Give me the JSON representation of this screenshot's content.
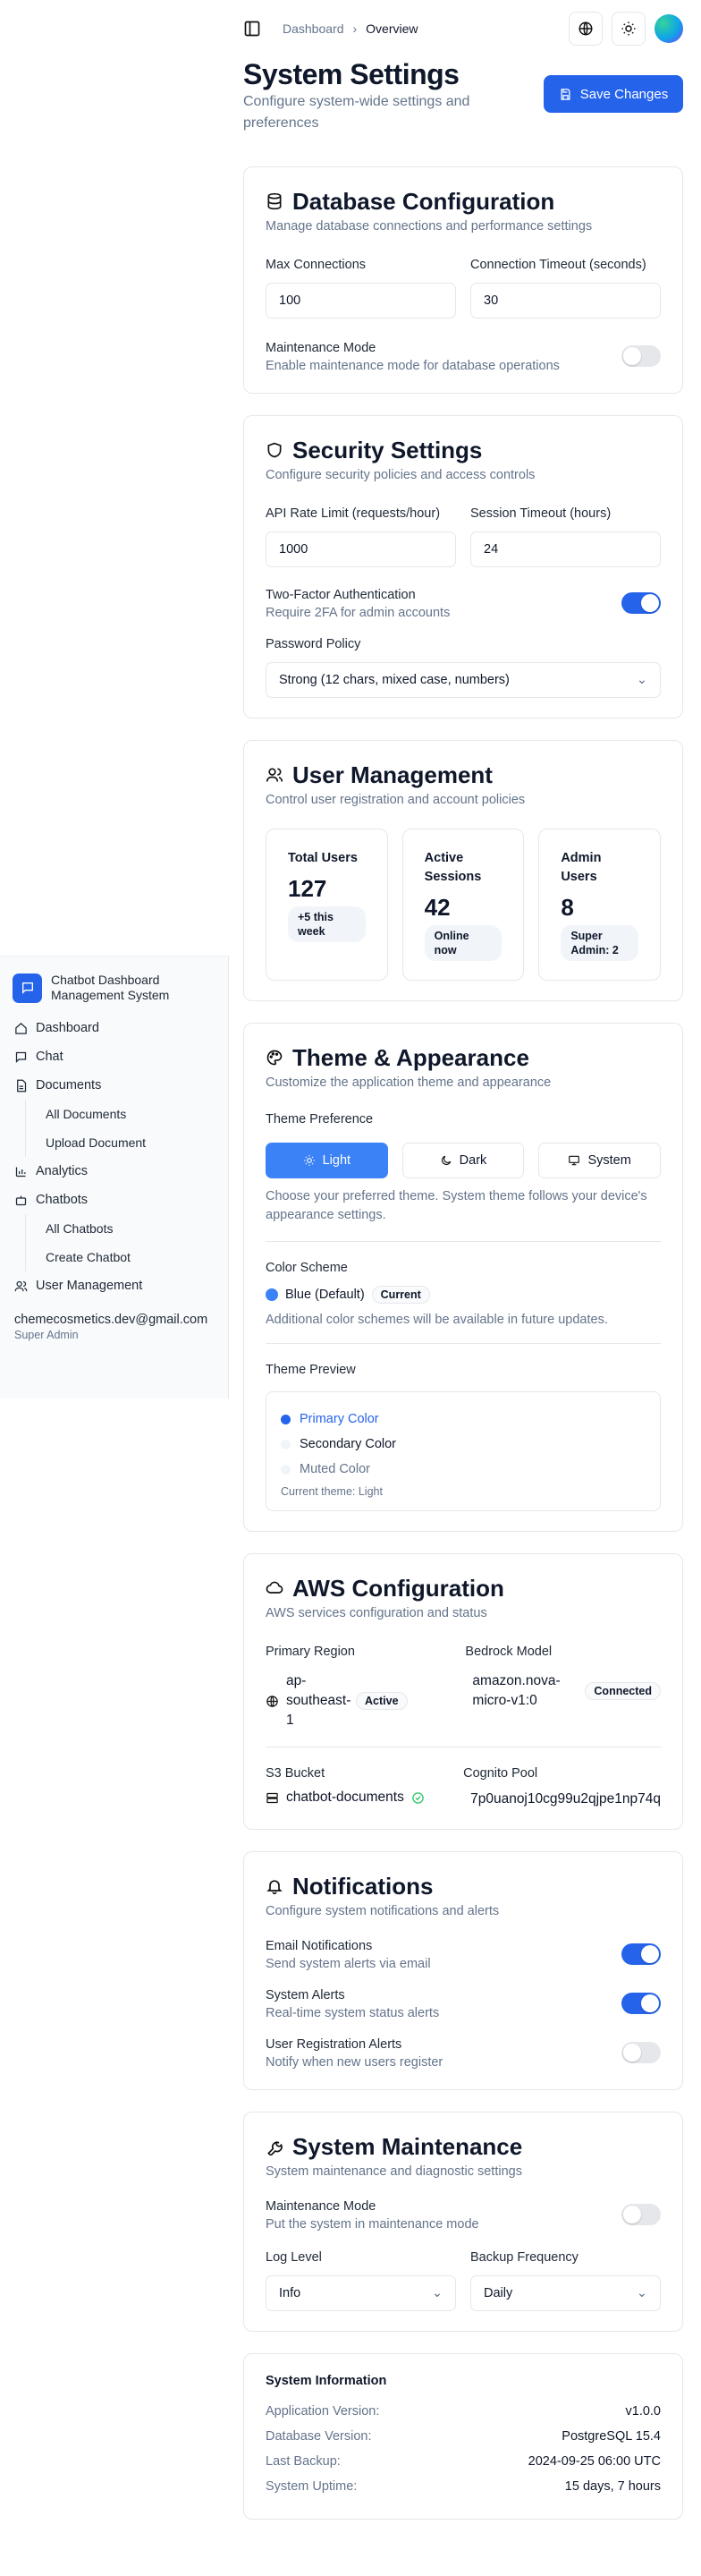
{
  "sidebar": {
    "brand_line1": "Chatbot Dashboard",
    "brand_line2": "Management System",
    "items": [
      {
        "label": "Dashboard"
      },
      {
        "label": "Chat"
      },
      {
        "label": "Documents"
      },
      {
        "label": "All Documents"
      },
      {
        "label": "Upload Document"
      },
      {
        "label": "Analytics"
      },
      {
        "label": "Chatbots"
      },
      {
        "label": "All Chatbots"
      },
      {
        "label": "Create Chatbot"
      },
      {
        "label": "User Management"
      }
    ],
    "user_email": "chemecosmetics.dev@gmail.com",
    "user_role": "Super Admin"
  },
  "topbar": {
    "crumb_parent": "Dashboard",
    "crumb_current": "Overview"
  },
  "header": {
    "title": "System Settings",
    "subtitle": "Configure system-wide settings and preferences",
    "save_label": "Save Changes"
  },
  "database": {
    "title": "Database Configuration",
    "desc": "Manage database connections and performance settings",
    "max_conn_label": "Max Connections",
    "max_conn_value": "100",
    "timeout_label": "Connection Timeout (seconds)",
    "timeout_value": "30",
    "maint_label": "Maintenance Mode",
    "maint_desc": "Enable maintenance mode for database operations"
  },
  "security": {
    "title": "Security Settings",
    "desc": "Configure security policies and access controls",
    "rate_label": "API Rate Limit (requests/hour)",
    "rate_value": "1000",
    "session_label": "Session Timeout (hours)",
    "session_value": "24",
    "twofa_label": "Two-Factor Authentication",
    "twofa_desc": "Require 2FA for admin accounts",
    "policy_label": "Password Policy",
    "policy_value": "Strong (12 chars, mixed case, numbers)"
  },
  "users": {
    "title": "User Management",
    "desc": "Control user registration and account policies",
    "stats": [
      {
        "title": "Total Users",
        "value": "127",
        "pill": "+5 this week"
      },
      {
        "title": "Active Sessions",
        "value": "42",
        "pill": "Online now"
      },
      {
        "title": "Admin Users",
        "value": "8",
        "pill": "Super Admin: 2"
      }
    ]
  },
  "theme": {
    "title": "Theme & Appearance",
    "desc": "Customize the application theme and appearance",
    "pref_label": "Theme Preference",
    "options": [
      "Light",
      "Dark",
      "System"
    ],
    "pref_help": "Choose your preferred theme. System theme follows your device's appearance settings.",
    "scheme_label": "Color Scheme",
    "scheme_value": "Blue (Default)",
    "scheme_badge": "Current",
    "scheme_help": "Additional color schemes will be available in future updates.",
    "preview_label": "Theme Preview",
    "preview_primary": "Primary Color",
    "preview_secondary": "Secondary Color",
    "preview_muted": "Muted Color",
    "preview_current": "Current theme: Light",
    "accent": "#2563eb"
  },
  "aws": {
    "title": "AWS Configuration",
    "desc": "AWS services configuration and status",
    "region_label": "Primary Region",
    "region_value": "ap-southeast-1",
    "region_badge": "Active",
    "bedrock_label": "Bedrock Model",
    "bedrock_value": "amazon.nova-micro-v1:0",
    "bedrock_badge": "Connected",
    "s3_label": "S3 Bucket",
    "s3_value": "chatbot-documents",
    "cognito_label": "Cognito Pool",
    "cognito_value": "7p0uanoj10cg99u2qjpe1np74q"
  },
  "notifications": {
    "title": "Notifications",
    "desc": "Configure system notifications and alerts",
    "items": [
      {
        "label": "Email Notifications",
        "desc": "Send system alerts via email"
      },
      {
        "label": "System Alerts",
        "desc": "Real-time system status alerts"
      },
      {
        "label": "User Registration Alerts",
        "desc": "Notify when new users register"
      }
    ]
  },
  "maintenance": {
    "title": "System Maintenance",
    "desc": "System maintenance and diagnostic settings",
    "mode_label": "Maintenance Mode",
    "mode_desc": "Put the system in maintenance mode",
    "log_label": "Log Level",
    "log_value": "Info",
    "backup_label": "Backup Frequency",
    "backup_value": "Daily"
  },
  "sysinfo": {
    "title": "System Information",
    "rows": [
      {
        "k": "Application Version:",
        "v": "v1.0.0"
      },
      {
        "k": "Database Version:",
        "v": "PostgreSQL 15.4"
      },
      {
        "k": "Last Backup:",
        "v": "2024-09-25 06:00 UTC"
      },
      {
        "k": "System Uptime:",
        "v": "15 days, 7 hours"
      }
    ]
  }
}
